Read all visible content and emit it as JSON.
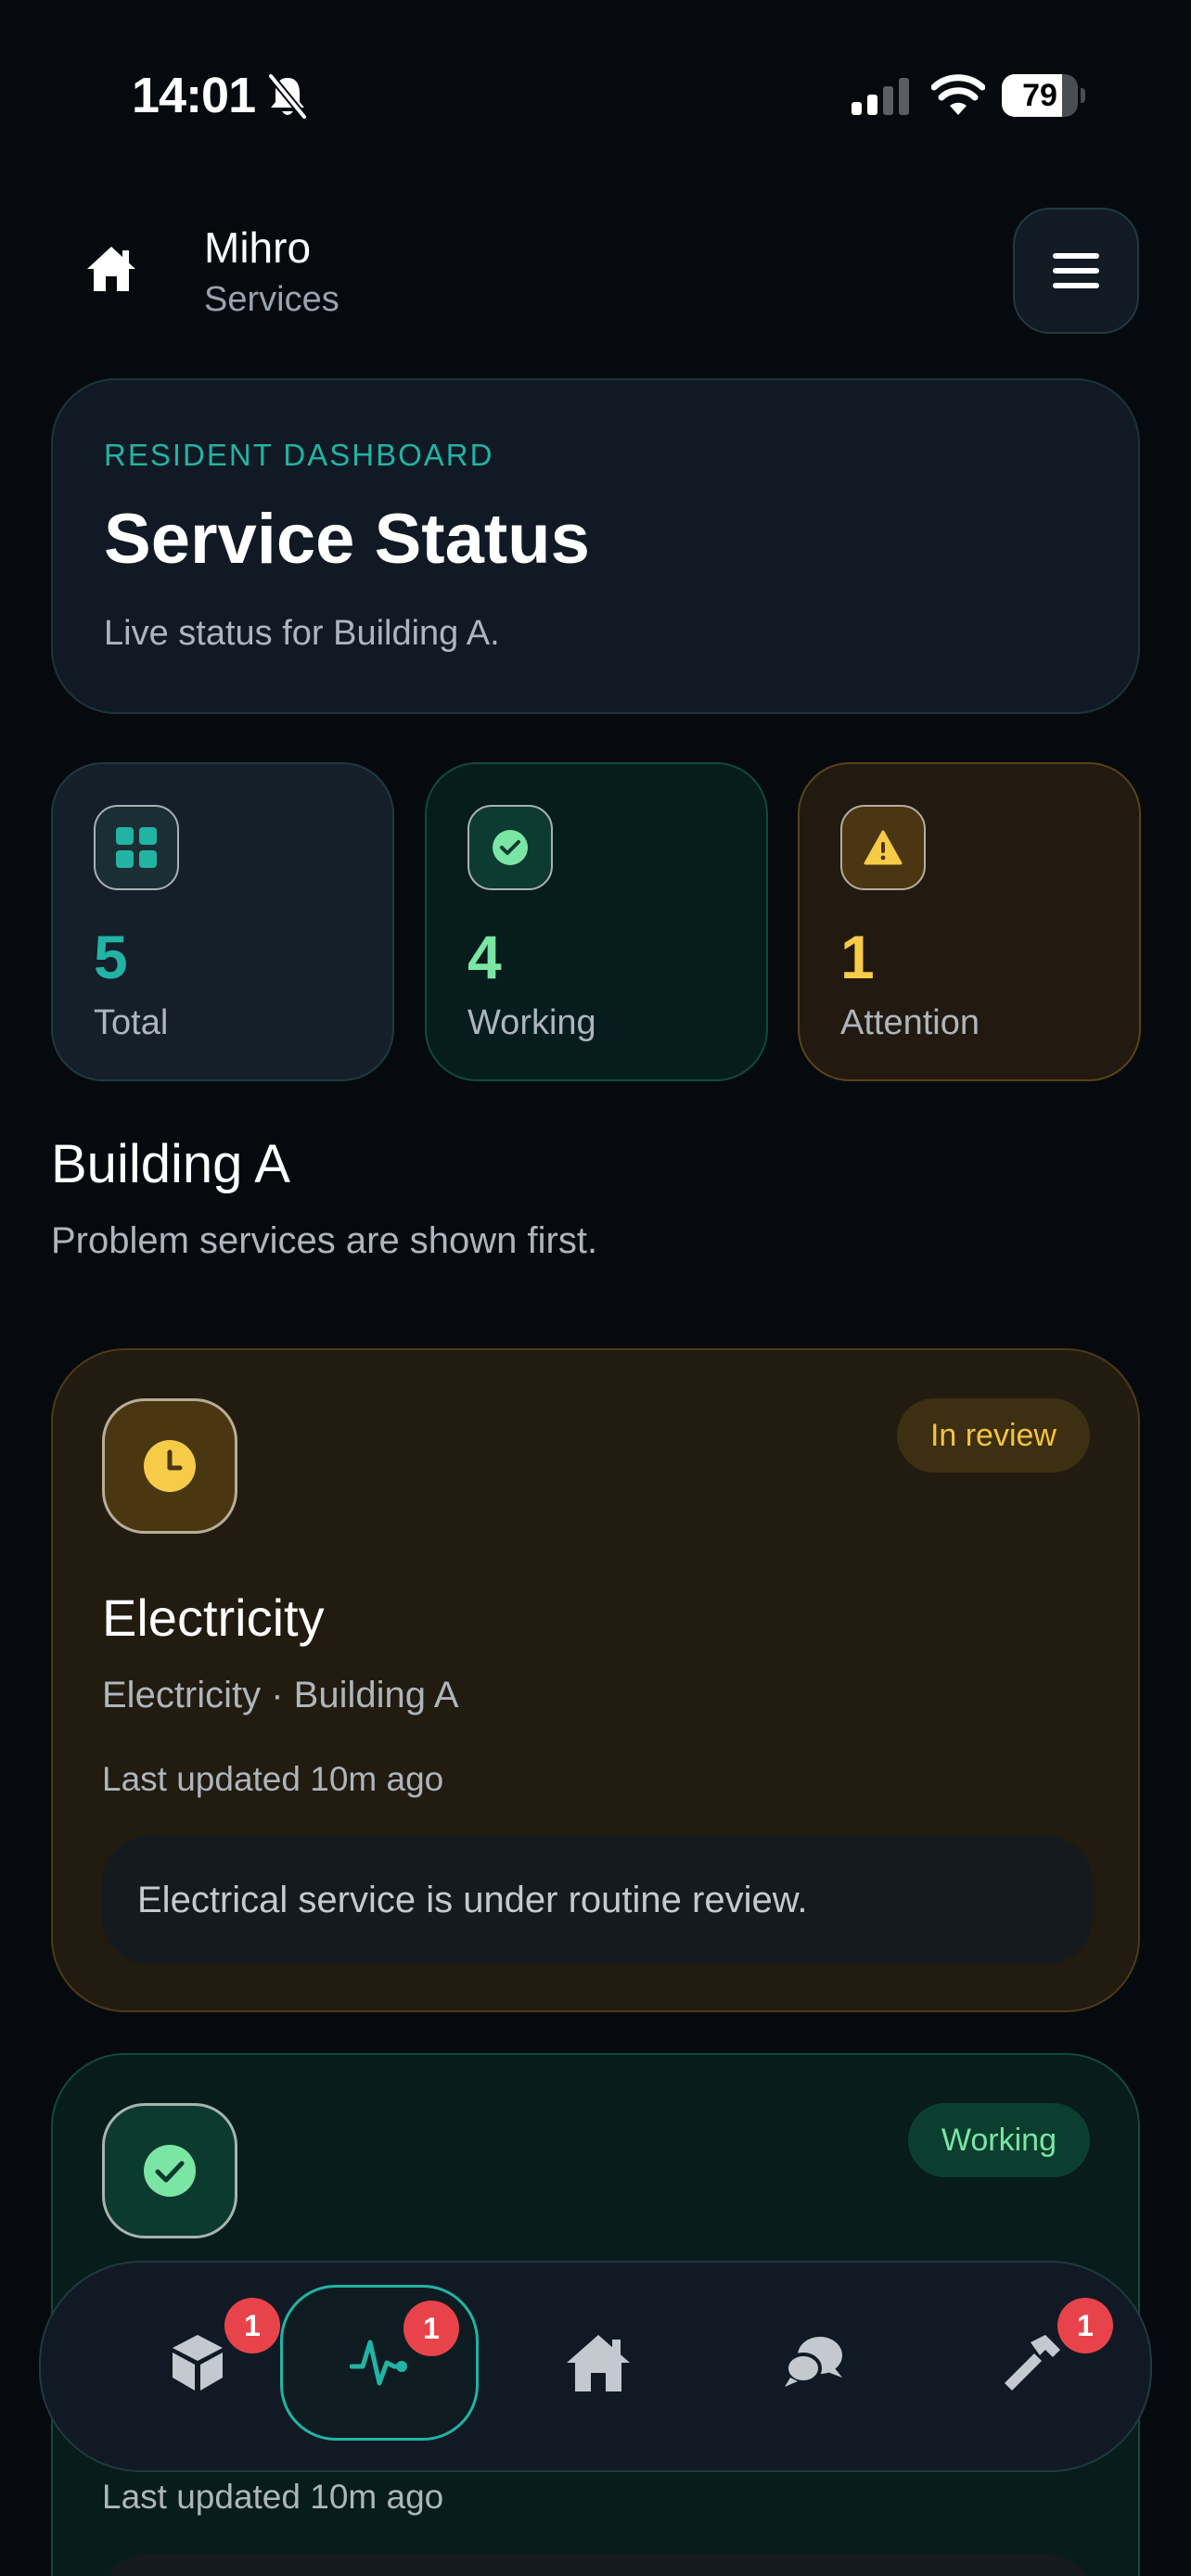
{
  "status_bar": {
    "time": "14:01",
    "battery": "79",
    "battery_level": 0.79
  },
  "header": {
    "title": "Mihro",
    "subtitle": "Services"
  },
  "hero": {
    "eyebrow": "RESIDENT DASHBOARD",
    "title": "Service Status",
    "description": "Live status for Building A."
  },
  "stats": {
    "total": {
      "value": "5",
      "label": "Total"
    },
    "working": {
      "value": "4",
      "label": "Working"
    },
    "attention": {
      "value": "1",
      "label": "Attention"
    }
  },
  "section": {
    "title": "Building A",
    "subtitle": "Problem services are shown first."
  },
  "services": [
    {
      "title": "Electricity",
      "status": "In review",
      "meta": "Electricity · Building A",
      "updated": "Last updated 10m ago",
      "note": "Electrical service is under routine review."
    },
    {
      "status": "Working",
      "updated": "Last updated 10m ago"
    }
  ],
  "nav": {
    "items": [
      {
        "icon": "cube-icon",
        "badge": "1"
      },
      {
        "icon": "activity-icon",
        "badge": "1",
        "active": true
      },
      {
        "icon": "home-icon"
      },
      {
        "icon": "chat-icon"
      },
      {
        "icon": "hammer-icon",
        "badge": "1"
      }
    ]
  },
  "colors": {
    "accent": "#22b3a4",
    "working": "#7be5a4",
    "attention": "#f6cb48",
    "badge": "#e8434a"
  }
}
